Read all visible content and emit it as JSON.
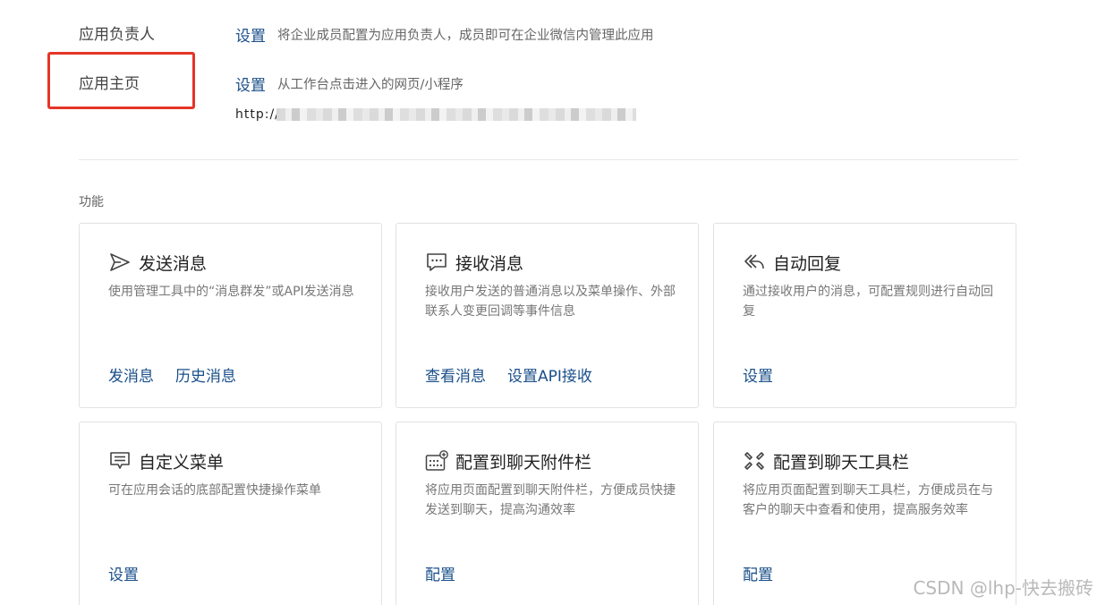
{
  "settings": {
    "owner": {
      "label": "应用负责人",
      "action": "设置",
      "desc": "将企业成员配置为应用负责人，成员即可在企业微信内管理此应用"
    },
    "homepage": {
      "label": "应用主页",
      "action": "设置",
      "desc": "从工作台点击进入的网页/小程序",
      "url": "http://"
    }
  },
  "functions": {
    "title": "功能",
    "cards": [
      {
        "icon": "send-icon",
        "title": "发送消息",
        "desc": "使用管理工具中的“消息群发”或API发送消息",
        "links": [
          "发消息",
          "历史消息"
        ]
      },
      {
        "icon": "chat-bubble-icon",
        "title": "接收消息",
        "desc": "接收用户发送的普通消息以及菜单操作、外部联系人变更回调等事件信息",
        "links": [
          "查看消息",
          "设置API接收"
        ]
      },
      {
        "icon": "reply-icon",
        "title": "自动回复",
        "desc": "通过接收用户的消息，可配置规则进行自动回复",
        "links": [
          "设置"
        ]
      },
      {
        "icon": "menu-icon",
        "title": "自定义菜单",
        "desc": "可在应用会话的底部配置快捷操作菜单",
        "links": [
          "设置"
        ]
      },
      {
        "icon": "attachment-bar-icon",
        "title": "配置到聊天附件栏",
        "desc": "将应用页面配置到聊天附件栏，方便成员快捷发送到聊天，提高沟通效率",
        "links": [
          "配置"
        ]
      },
      {
        "icon": "toolbar-icon",
        "title": "配置到聊天工具栏",
        "desc": "将应用页面配置到聊天工具栏，方便成员在与客户的聊天中查看和使用，提高服务效率",
        "links": [
          "配置"
        ]
      }
    ]
  },
  "watermark": "CSDN @lhp-快去搬砖",
  "colors": {
    "link": "#1a4f8a",
    "highlight": "#e53528",
    "card_border": "#e2e2e2"
  }
}
